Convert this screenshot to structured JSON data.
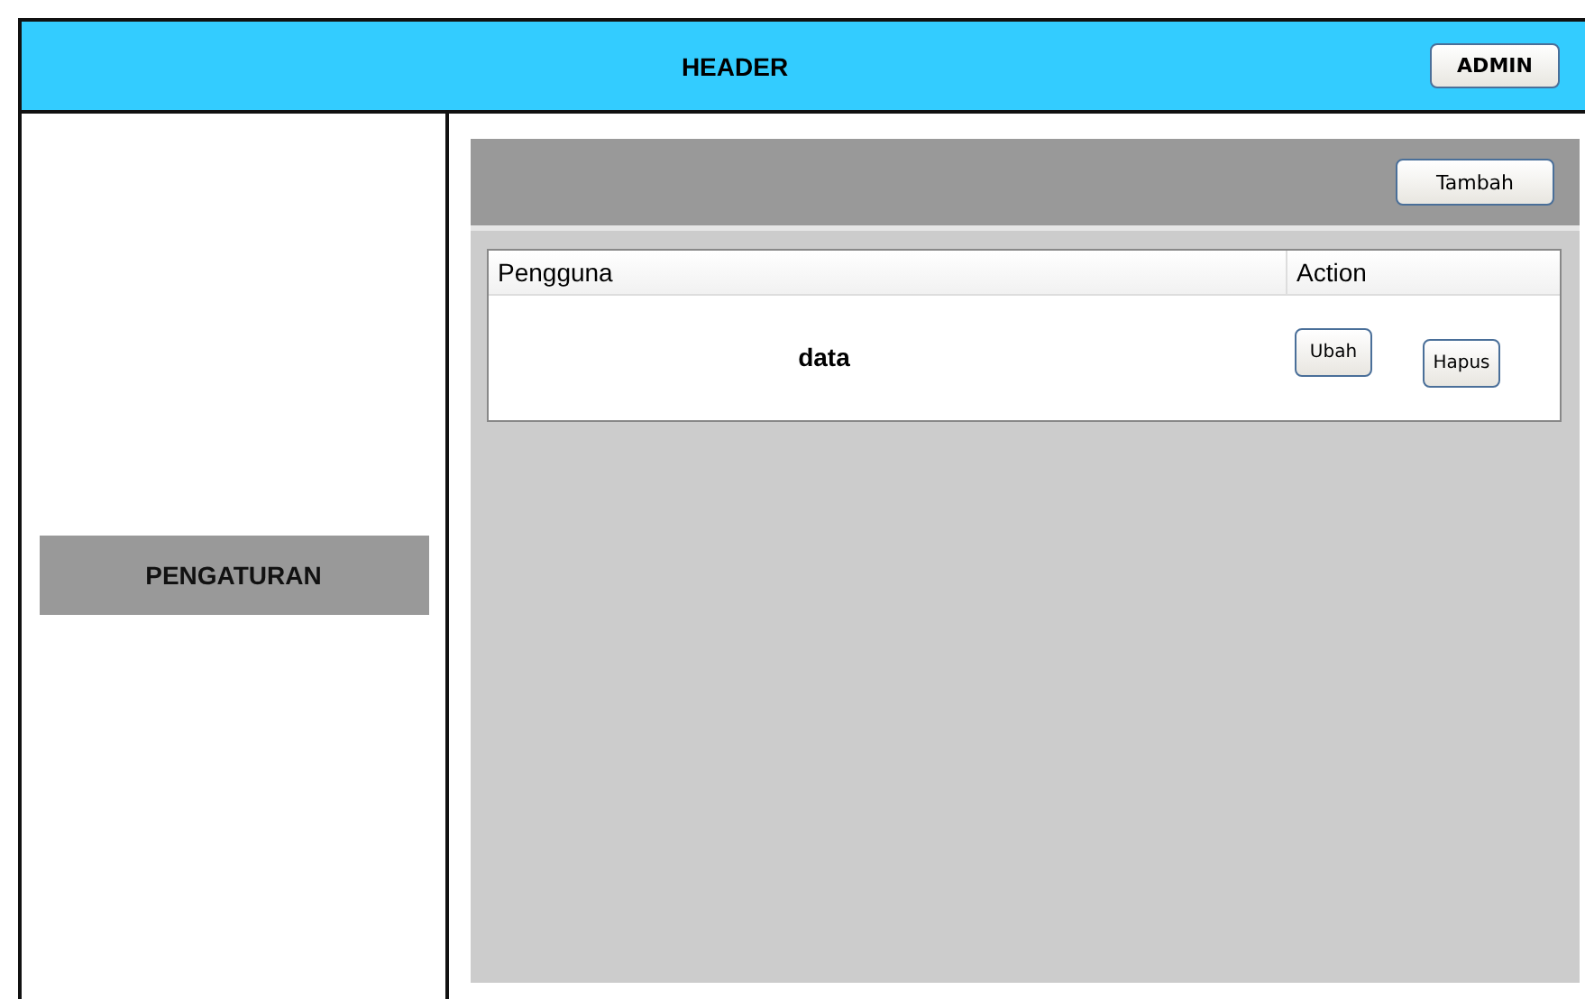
{
  "header": {
    "title": "HEADER",
    "button": "ADMIN"
  },
  "sidebar": {
    "items": [
      "PENGATURAN"
    ]
  },
  "toolbar": {
    "buttons": [
      "Tambah"
    ]
  },
  "table": {
    "columns": [
      "Pengguna",
      "Action"
    ],
    "rows": [
      {
        "cells": [
          "data"
        ],
        "actions": [
          "Ubah",
          "Hapus"
        ]
      }
    ]
  }
}
